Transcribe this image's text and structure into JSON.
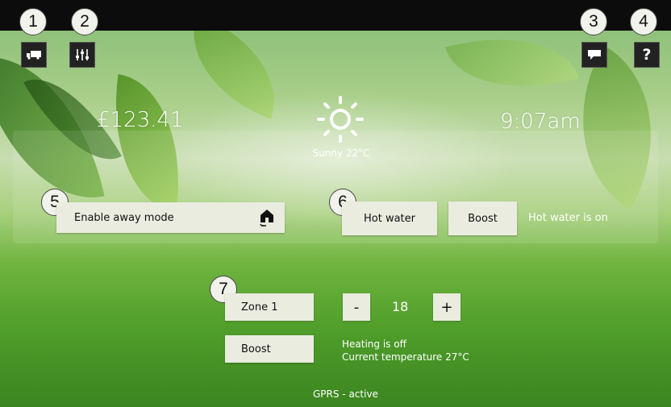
{
  "callouts": [
    "1",
    "2",
    "3",
    "4",
    "5",
    "6",
    "7"
  ],
  "header": {
    "balance": "£123.41",
    "weather": "Sunny 22°C",
    "time": "9:07am"
  },
  "top_buttons": {
    "help_label": "?"
  },
  "icons": {
    "btn1": "truck-icon",
    "btn2": "sliders-icon",
    "btn3": "message-icon",
    "btn4": "help-icon",
    "weather": "sun-icon",
    "away": "house-icon"
  },
  "away": {
    "label": "Enable away mode"
  },
  "hot_water": {
    "button_label": "Hot water",
    "boost_label": "Boost",
    "status": "Hot water is on"
  },
  "heating": {
    "zone_label": "Zone 1",
    "decrease_label": "-",
    "setpoint": "18",
    "increase_label": "+",
    "boost_label": "Boost",
    "status": "Heating is off",
    "current_temperature": "Current temperature 27°C"
  },
  "footer": {
    "connection": "GPRS - active"
  },
  "colors": {
    "button_bg": "#e9ecdf",
    "top_bar": "#0c0c0c",
    "text_light": "#ffffff"
  }
}
